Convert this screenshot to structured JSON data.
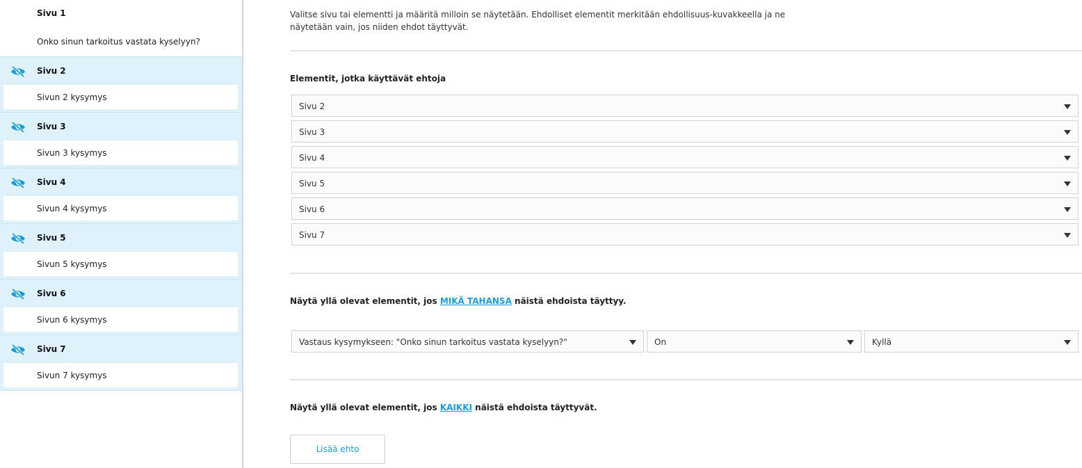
{
  "sidebar": {
    "first_page": {
      "title": "Sivu 1",
      "question": "Onko sinun tarkoitus vastata kyselyyn?"
    },
    "conditional_pages": [
      {
        "title": "Sivu 2",
        "question": "Sivun 2 kysymys",
        "icon": "hidden-eye-icon"
      },
      {
        "title": "Sivu 3",
        "question": "Sivun 3 kysymys",
        "icon": "hidden-eye-icon"
      },
      {
        "title": "Sivu 4",
        "question": "Sivun 4 kysymys",
        "icon": "hidden-eye-icon"
      },
      {
        "title": "Sivu 5",
        "question": "Sivun 5 kysymys",
        "icon": "hidden-eye-icon"
      },
      {
        "title": "Sivu 6",
        "question": "Sivun 6 kysymys",
        "icon": "hidden-eye-icon"
      },
      {
        "title": "Sivu 7",
        "question": "Sivun 7 kysymys",
        "icon": "hidden-eye-icon"
      }
    ]
  },
  "main": {
    "intro_line1": "Valitse sivu tai elementti ja määritä milloin se näytetään. Ehdolliset elementit merkitään ehdollisuus-kuvakkeella ja ne",
    "intro_line2": "näytetään vain, jos niiden ehdot täyttyvät.",
    "elements_label": "Elementit, jotka käyttävät ehtoja",
    "element_selects": [
      "Sivu 2",
      "Sivu 3",
      "Sivu 4",
      "Sivu 5",
      "Sivu 6",
      "Sivu 7"
    ],
    "any_label_prefix": "Näytä yllä olevat elementit, jos ",
    "any_label_link": "MIKÄ TAHANSA",
    "any_label_suffix": " näistä ehdoista täyttyy.",
    "condition": {
      "question_select": "Vastaus kysymykseen: \"Onko sinun tarkoitus vastata kyselyyn?\"",
      "operator_select": "On",
      "value_select": "Kyllä"
    },
    "all_label_prefix": "Näytä yllä olevat elementit, jos ",
    "all_label_link": "KAIKKI",
    "all_label_suffix": " näistä ehdoista täyttyvät.",
    "add_condition_button": "Lisää ehto"
  },
  "colors": {
    "accent": "#1a9ed8",
    "conditional_bg": "#dff2fb"
  }
}
